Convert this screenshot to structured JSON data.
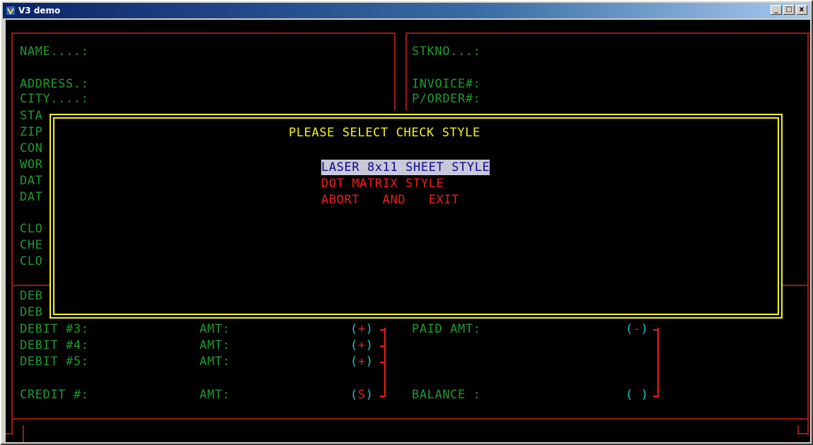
{
  "window": {
    "title": "V3 demo",
    "controls": [
      "_",
      "□",
      "x"
    ]
  },
  "left_labels": {
    "name": "NAME....:",
    "address": "ADDRESS.:",
    "city": "CITY....:"
  },
  "left_partial": [
    "STA",
    "ZIP",
    "CON",
    "WOR",
    "DAT",
    "DAT",
    "CLO",
    "CHE",
    "CLO",
    "DEB",
    "DEB"
  ],
  "right_labels": {
    "stkno": "STKNO...:",
    "invoice": "INVOICE#:",
    "porder": "P/ORDER#:"
  },
  "dialog": {
    "title": "PLEASE SELECT CHECK STYLE",
    "options": [
      "LASER 8x11 SHEET STYLE",
      "DOT MATRIX STYLE",
      "ABORT   AND   EXIT"
    ],
    "selected_index": 0
  },
  "lower": {
    "debit3": "DEBIT #3:",
    "debit4": "DEBIT #4:",
    "debit5": "DEBIT #5:",
    "credit": "CREDIT #:",
    "amt": "AMT:",
    "plus": "+",
    "s": "S",
    "paid_amt": "PAID AMT:",
    "minus": "-",
    "balance": "BALANCE :",
    "open_paren": "(",
    "close_paren": ")"
  },
  "colors": {
    "green": "#1f9a2e",
    "red": "#ee1c1c",
    "yellow": "#f2f21a",
    "cyan": "#18c6c6",
    "highlight_bg": "#c8c8d8",
    "highlight_fg": "#0b0b8a"
  }
}
